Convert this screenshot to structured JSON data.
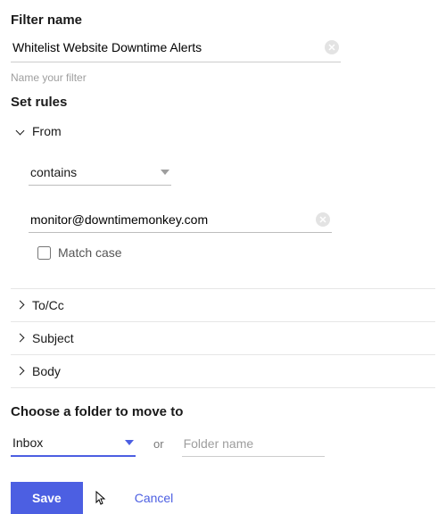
{
  "filter": {
    "heading": "Filter name",
    "value": "Whitelist Website Downtime Alerts",
    "helper": "Name your filter"
  },
  "rules": {
    "heading": "Set rules",
    "from": {
      "label": "From",
      "condition": "contains",
      "value": "monitor@downtimemonkey.com",
      "match_case_label": "Match case"
    },
    "tocc": {
      "label": "To/Cc"
    },
    "subject": {
      "label": "Subject"
    },
    "body": {
      "label": "Body"
    }
  },
  "folder": {
    "heading": "Choose a folder to move to",
    "selected": "Inbox",
    "or_label": "or",
    "placeholder": "Folder name"
  },
  "buttons": {
    "save": "Save",
    "cancel": "Cancel"
  }
}
